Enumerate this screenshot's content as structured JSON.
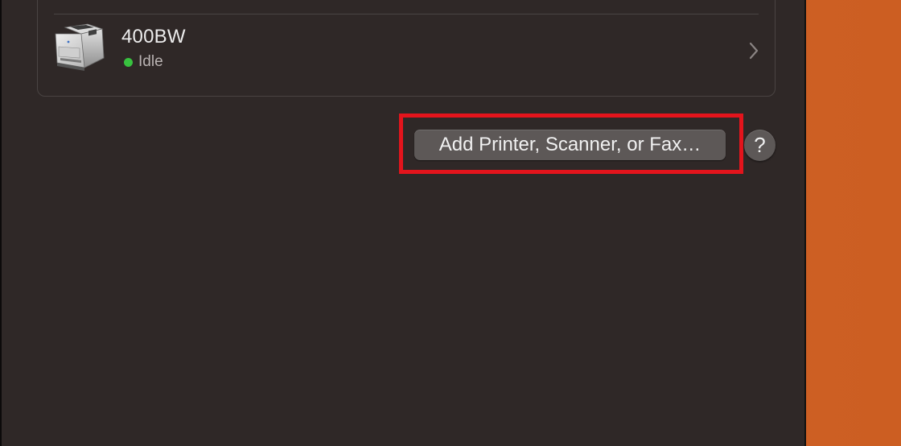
{
  "printers": [
    {
      "name": "400BW",
      "status": "Idle",
      "status_color": "#38c23f",
      "icon": "printer-icon"
    }
  ],
  "actions": {
    "add_label": "Add Printer, Scanner, or Fax…",
    "help_label": "?"
  },
  "colors": {
    "window_bg": "#2f2827",
    "desktop_bg": "#cc5e22",
    "highlight": "#e3141c",
    "button_bg": "#5d5857"
  }
}
